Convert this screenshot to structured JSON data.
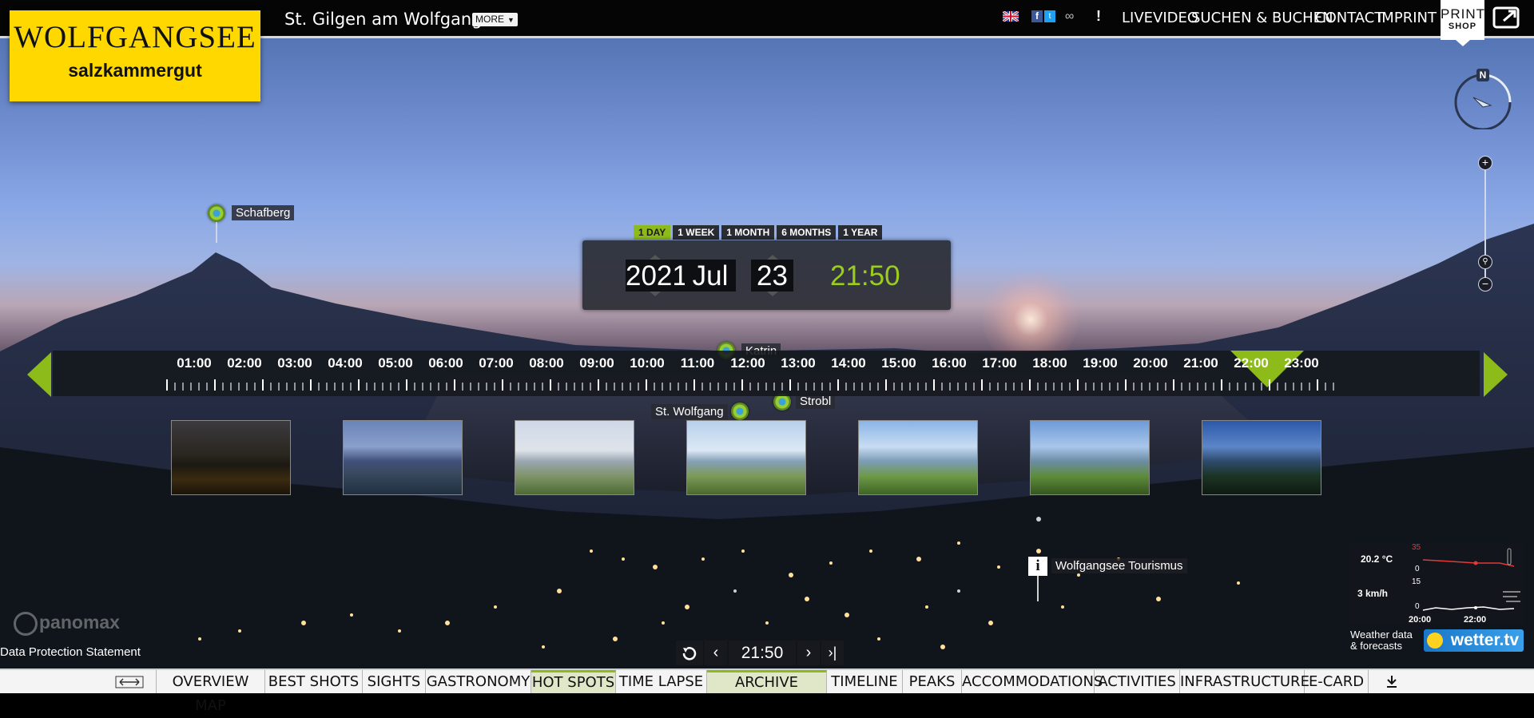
{
  "header": {
    "logo_line1": "WOLFGANGSEE",
    "logo_line2": "salzkammergut",
    "place": "St. Gilgen am Wolfgangsee",
    "more_label": "MORE",
    "exclaim": "!",
    "nav": [
      "LIVEVIDEO",
      "SUCHEN & BUCHEN",
      "CONTACT",
      "IMPRINT"
    ],
    "print_line1": "PRINT",
    "print_line2": "SHOP"
  },
  "compass_label": "N",
  "pois": {
    "schafberg": "Schafberg",
    "katrin": "Katrin",
    "st_wolfgang": "St. Wolfgang",
    "strobl": "Strobl",
    "tourism": "Wolfgangsee Tourismus"
  },
  "periods": [
    "1 DAY",
    "1 WEEK",
    "1 MONTH",
    "6 MONTHS",
    "1 YEAR"
  ],
  "active_period": "1 DAY",
  "date": {
    "year": "2021",
    "month": "Jul",
    "day": "23",
    "time": "21:50"
  },
  "timeline": {
    "hours": [
      "01:00",
      "02:00",
      "03:00",
      "04:00",
      "05:00",
      "06:00",
      "07:00",
      "08:00",
      "09:00",
      "10:00",
      "11:00",
      "12:00",
      "13:00",
      "14:00",
      "15:00",
      "16:00",
      "17:00",
      "18:00",
      "19:00",
      "20:00",
      "21:00",
      "22:00",
      "23:00"
    ],
    "selected": "22:00"
  },
  "weather": {
    "temp": "20.2 °C",
    "wind": "3 km/h",
    "scale_temp_top": "35",
    "scale_temp_bottom": "0",
    "scale_wind_top": "15",
    "scale_wind_bottom": "0",
    "time1": "20:00",
    "time2": "22:00",
    "label1": "Weather data",
    "label2": "& forecasts",
    "logo": "wetter.tv"
  },
  "panomax": "panomax",
  "data_protection": "Data Protection Statement",
  "time_control": {
    "current": "21:50"
  },
  "bottom_nav": [
    "OVERVIEW MAP",
    "BEST SHOTS",
    "SIGHTS",
    "GASTRONOMY",
    "HOT SPOTS",
    "TIME LAPSE",
    "ARCHIVE",
    "TIMELINE",
    "PEAKS",
    "ACCOMMODATIONS",
    "ACTIVITIES",
    "INFRASTRUCTURE",
    "E-CARD"
  ],
  "colors": {
    "accent": "#8dbb1a",
    "logo_yellow": "#ffd800",
    "topbar": "#050505"
  }
}
